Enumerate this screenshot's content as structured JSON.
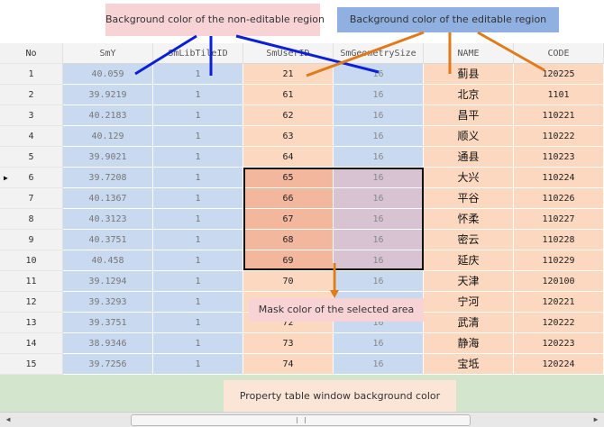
{
  "table": {
    "columns": [
      "No",
      "SmY",
      "SmLibTileID",
      "SmUserID",
      "SmGeometrySize",
      "NAME",
      "CODE"
    ],
    "rows": [
      {
        "no": "1",
        "smy": "40.059",
        "tile": "1",
        "user": "21",
        "geo": "16",
        "name": "蓟县",
        "code": "120225"
      },
      {
        "no": "2",
        "smy": "39.9219",
        "tile": "1",
        "user": "61",
        "geo": "16",
        "name": "北京",
        "code": "1101"
      },
      {
        "no": "3",
        "smy": "40.2183",
        "tile": "1",
        "user": "62",
        "geo": "16",
        "name": "昌平",
        "code": "110221"
      },
      {
        "no": "4",
        "smy": "40.129",
        "tile": "1",
        "user": "63",
        "geo": "16",
        "name": "顺义",
        "code": "110222"
      },
      {
        "no": "5",
        "smy": "39.9021",
        "tile": "1",
        "user": "64",
        "geo": "16",
        "name": "通县",
        "code": "110223"
      },
      {
        "no": "6",
        "smy": "39.7208",
        "tile": "1",
        "user": "65",
        "geo": "16",
        "name": "大兴",
        "code": "110224"
      },
      {
        "no": "7",
        "smy": "40.1367",
        "tile": "1",
        "user": "66",
        "geo": "16",
        "name": "平谷",
        "code": "110226"
      },
      {
        "no": "8",
        "smy": "40.3123",
        "tile": "1",
        "user": "67",
        "geo": "16",
        "name": "怀柔",
        "code": "110227"
      },
      {
        "no": "9",
        "smy": "40.3751",
        "tile": "1",
        "user": "68",
        "geo": "16",
        "name": "密云",
        "code": "110228"
      },
      {
        "no": "10",
        "smy": "40.458",
        "tile": "1",
        "user": "69",
        "geo": "16",
        "name": "延庆",
        "code": "110229"
      },
      {
        "no": "11",
        "smy": "39.1294",
        "tile": "1",
        "user": "70",
        "geo": "16",
        "name": "天津",
        "code": "120100"
      },
      {
        "no": "12",
        "smy": "39.3293",
        "tile": "1",
        "user": "71",
        "geo": "16",
        "name": "宁河",
        "code": "120221"
      },
      {
        "no": "13",
        "smy": "39.3751",
        "tile": "1",
        "user": "72",
        "geo": "16",
        "name": "武清",
        "code": "120222"
      },
      {
        "no": "14",
        "smy": "38.9346",
        "tile": "1",
        "user": "73",
        "geo": "16",
        "name": "静海",
        "code": "120223"
      },
      {
        "no": "15",
        "smy": "39.7256",
        "tile": "1",
        "user": "74",
        "geo": "16",
        "name": "宝坻",
        "code": "120224"
      }
    ],
    "current_row_marker": "▶",
    "selected_rows": [
      6,
      7,
      8,
      9,
      10
    ]
  },
  "annotations": {
    "non_editable": "Background color of the non-editable region",
    "editable": "Background color of the editable region",
    "mask": "Mask color of the selected area",
    "property_bg": "Property table window background color"
  },
  "scrollbar": {
    "left_arrow": "◀",
    "right_arrow": "▶"
  },
  "colors": {
    "non_editable_bg": "#c9daf0",
    "editable_bg": "#fbd8bf",
    "mask": "#f3b79e",
    "property_bg": "#d3e6cd",
    "arrow_blue": "#0a1fd8",
    "arrow_orange": "#e07b1a"
  }
}
